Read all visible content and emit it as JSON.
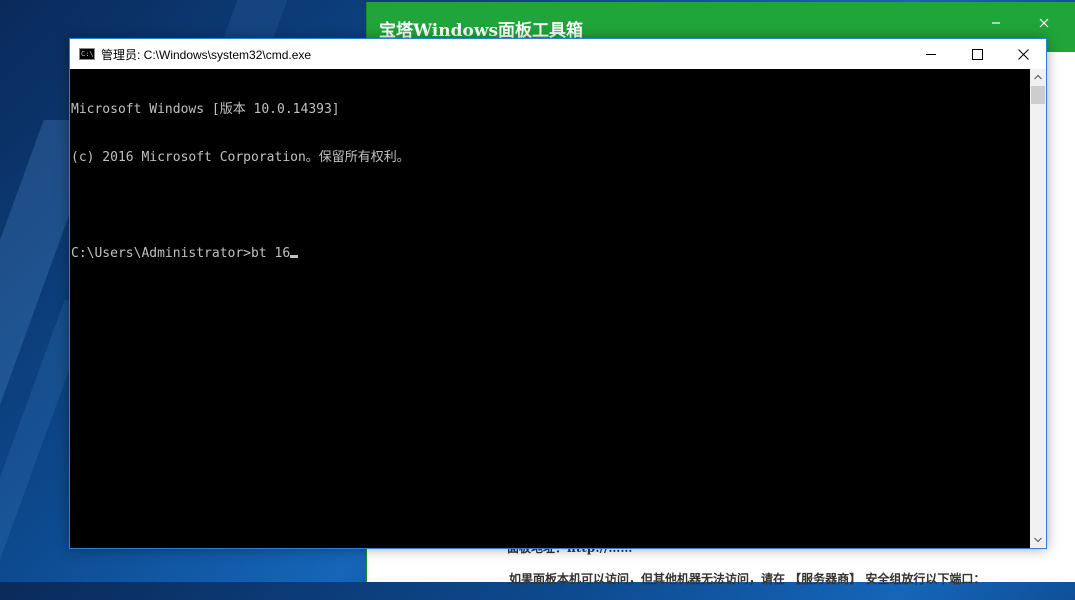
{
  "bt_window": {
    "title": "宝塔Windows面板工具箱",
    "body_lines": {
      "partial": "面板地址：http://……",
      "note": "如果面板本机可以访问，但其他机器无法访问，请在 【服务器商】 安全组放行以下端口："
    }
  },
  "cmd_window": {
    "title": "管理员: C:\\Windows\\system32\\cmd.exe",
    "icon_text": "C:\\",
    "console_lines": [
      "Microsoft Windows [版本 10.0.14393]",
      "(c) 2016 Microsoft Corporation。保留所有权利。",
      "",
      "C:\\Users\\Administrator>bt 16"
    ]
  },
  "colors": {
    "bt_green": "#20a53a",
    "console_bg": "#000000",
    "console_text": "#c0c0c0",
    "window_border": "#2b7fd4"
  },
  "icons": {
    "minimize": "minimize-icon",
    "maximize": "maximize-icon",
    "close": "close-icon",
    "scroll_up": "chevron-up-icon",
    "scroll_down": "chevron-down-icon"
  }
}
